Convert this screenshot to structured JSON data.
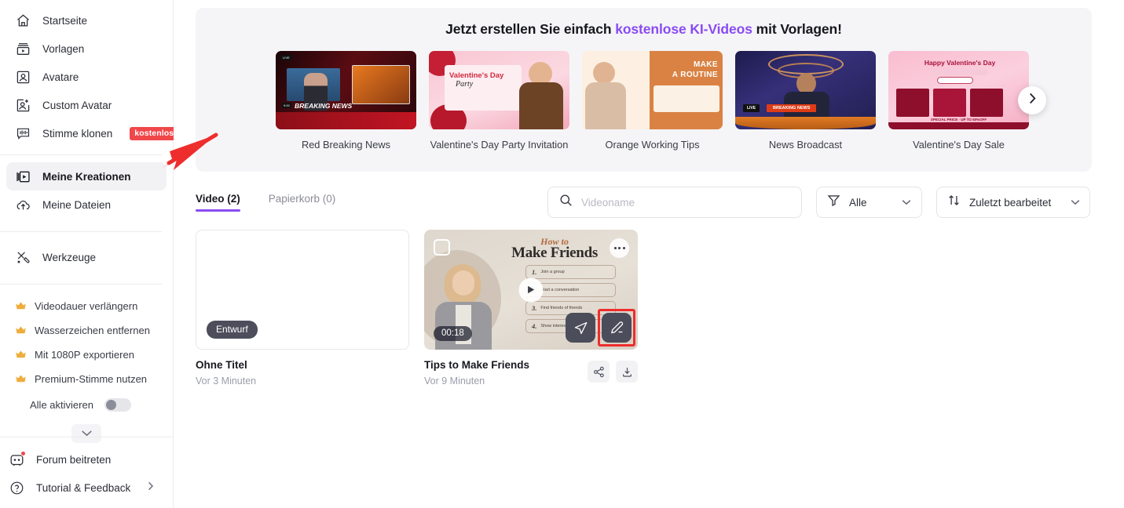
{
  "sidebar": {
    "nav_items": [
      {
        "label": "Startseite",
        "icon": "home-icon"
      },
      {
        "label": "Vorlagen",
        "icon": "templates-icon"
      },
      {
        "label": "Avatare",
        "icon": "avatar-icon"
      },
      {
        "label": "Custom Avatar",
        "icon": "avatar-add-icon"
      },
      {
        "label": "Stimme klonen",
        "icon": "voice-clone-icon",
        "badge": "kostenlos"
      }
    ],
    "creations": {
      "label": "Meine Kreationen",
      "icon": "my-creations-icon",
      "active": true
    },
    "files": {
      "label": "Meine Dateien",
      "icon": "upload-cloud-icon"
    },
    "tools": {
      "label": "Werkzeuge",
      "icon": "tools-icon"
    },
    "pro_features": [
      {
        "label": "Videodauer verlängern",
        "icon": "crown-icon"
      },
      {
        "label": "Wasserzeichen entfernen",
        "icon": "crown-icon"
      },
      {
        "label": "Mit 1080P exportieren",
        "icon": "crown-icon"
      },
      {
        "label": "Premium-Stimme nutzen",
        "icon": "crown-icon"
      }
    ],
    "enable_all": {
      "label": "Alle aktivieren",
      "state": "off"
    },
    "expander_icon": "chevron-down-icon",
    "bottom_items": [
      {
        "label": "Forum beitreten",
        "icon": "discord-icon",
        "has_notification": true
      },
      {
        "label": "Tutorial & Feedback",
        "icon": "help-circle-icon",
        "has_chevron": true
      }
    ]
  },
  "promo": {
    "title_part1": "Jetzt erstellen Sie einfach ",
    "title_accent": "kostenlose KI-Videos",
    "title_part2": " mit Vorlagen!",
    "accent_color": "#8a4bf2",
    "next_icon": "chevron-right-icon",
    "templates": [
      {
        "name": "Red Breaking News",
        "overlay_title": "BREAKING NEWS",
        "overlay_tag": "LIVE",
        "timecode": "9:00"
      },
      {
        "name": "Valentine's Day Party Invitation",
        "overlay_title": "Valentine's Day",
        "overlay_sub": "Party"
      },
      {
        "name": "Orange Working Tips",
        "overlay_title": "MAKE",
        "overlay_sub": "A ROUTINE"
      },
      {
        "name": "News Broadcast",
        "overlay_tag": "LIVE",
        "overlay_title": "BREAKING NEWS"
      },
      {
        "name": "Valentine's Day Sale",
        "overlay_title": "Happy Valentine's Day",
        "overlay_sub": "SPECIAL PRICE · UP TO 50%OFF"
      }
    ]
  },
  "toolbar": {
    "tabs": [
      {
        "label": "Video (2)",
        "active": true
      },
      {
        "label": "Papierkorb (0)",
        "active": false
      }
    ],
    "search": {
      "placeholder": "Videoname",
      "value": "",
      "icon": "search-icon"
    },
    "filter": {
      "label": "Alle",
      "icon": "filter-icon",
      "chevron": "chevron-down-icon"
    },
    "sort": {
      "label": "Zuletzt bearbeitet",
      "icon": "sort-icon",
      "chevron": "chevron-down-icon"
    }
  },
  "videos": [
    {
      "title": "Ohne Titel",
      "time": "Vor 3 Minuten",
      "status_badge": "Entwurf",
      "has_thumbnail": false
    },
    {
      "title": "Tips to Make Friends",
      "time": "Vor 9 Minuten",
      "duration": "00:18",
      "has_thumbnail": true,
      "thumb_title_script": "How to",
      "thumb_title_main": "Make Friends",
      "thumb_steps": [
        {
          "num": "1.",
          "text": "Join a group"
        },
        {
          "num": "2.",
          "text": "Start a conversation"
        },
        {
          "num": "3.",
          "text": "Find friends of friends"
        },
        {
          "num": "4.",
          "text": "Show interest"
        }
      ],
      "actions": {
        "share_icon": "share-icon",
        "download_icon": "download-icon",
        "send_icon": "send-icon",
        "edit_icon": "edit-pencil-icon",
        "more_icon": "more-options-icon",
        "play_icon": "play-icon",
        "checkbox_icon": "select-checkbox"
      }
    }
  ],
  "annotation": {
    "type": "red-arrow",
    "points_to": "Meine Kreationen",
    "color": "#ee2d2d"
  }
}
